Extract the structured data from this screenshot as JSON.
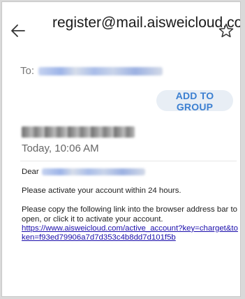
{
  "header": {
    "sender_email": "register@mail.aisweicloud.com"
  },
  "recipients": {
    "to_label": "To:"
  },
  "actions": {
    "add_to_group": "ADD TO GROUP"
  },
  "message": {
    "date": "Today, 10:06 AM",
    "greeting": "Dear",
    "line1": "Please activate your account within 24 hours.",
    "line2": "Please copy the following link into the browser address bar to open, or click it to activate your account.",
    "link": "https://www.aisweicloud.com/active_account?key=charget&token=f93ed79906a7d7d353c4b8dd7d101f5b"
  },
  "colors": {
    "accent": "#3b7fd1",
    "link": "#1a0dab"
  }
}
